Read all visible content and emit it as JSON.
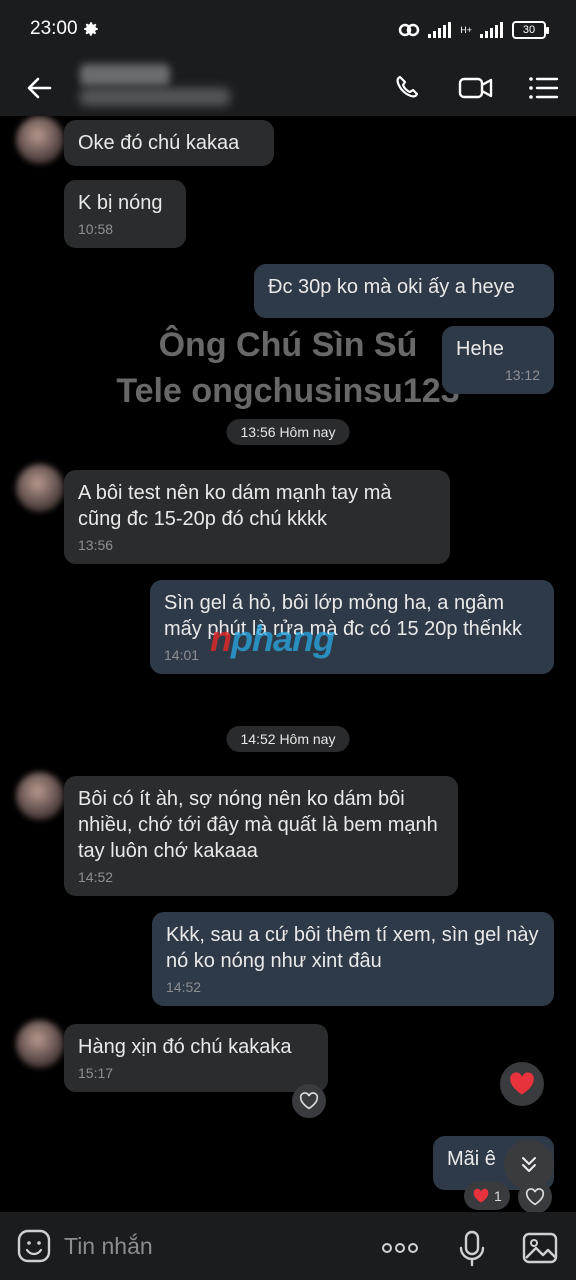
{
  "status": {
    "time": "23:00",
    "network": "H+",
    "battery": "30"
  },
  "header": {},
  "watermark": {
    "line1": "Ông Chú Sìn Sú",
    "line2": "Tele ongchusinsu123"
  },
  "brand": {
    "red": "n",
    "blue": "phang"
  },
  "messages": [
    {
      "text": "Oke đó chú  kakaa",
      "time": ""
    },
    {
      "text": "K bị nóng",
      "time": "10:58"
    },
    {
      "text": "Đc 30p ko mà oki ấy a heye",
      "time": ""
    },
    {
      "text": "Hehe",
      "time": "13:12"
    },
    {
      "text": "A bôi test nên ko dám mạnh tay mà cũng đc 15-20p đó chú kkkk",
      "time": "13:56"
    },
    {
      "text": "Sìn gel á hỏ, bôi lớp mỏng ha, a ngâm mấy phút là rửa mà đc có 15 20p thếnkk",
      "time": "14:01"
    },
    {
      "text": "Bôi có ít àh, sợ nóng nên ko dám bôi nhiều, chớ tới đây mà quất là bem mạnh tay luôn chớ kakaaa",
      "time": "14:52"
    },
    {
      "text": "Kkk, sau a cứ bôi thêm tí xem, sìn gel này nó ko nóng như xint đâu",
      "time": "14:52"
    },
    {
      "text": "Hàng xịn đó chú kakaka",
      "time": "15:17"
    },
    {
      "text": "Mãi ê",
      "time": ""
    }
  ],
  "dividers": [
    "13:56 Hôm nay",
    "14:52 Hôm nay"
  ],
  "reactions": {
    "count": "1"
  },
  "input": {
    "placeholder": "Tin nhắn"
  },
  "colors": {
    "accent_heart": "#e8323c",
    "bubble_in": "#2b2c2e",
    "bubble_out": "#2f3a48"
  }
}
